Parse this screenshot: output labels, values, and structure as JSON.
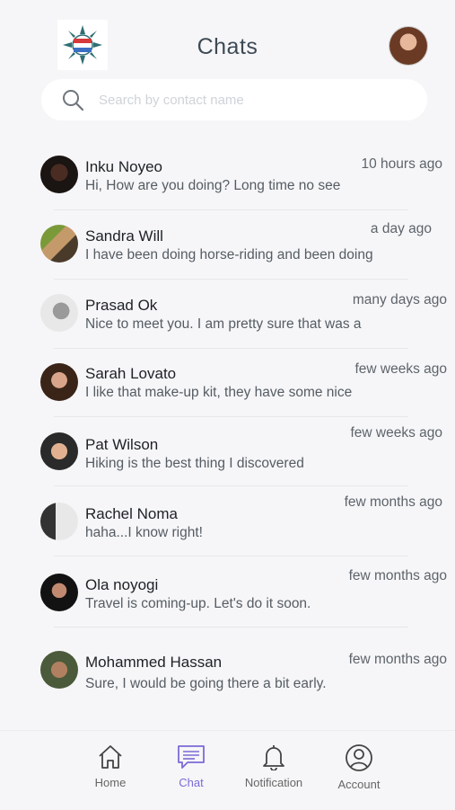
{
  "header": {
    "title": "Chats"
  },
  "search": {
    "placeholder": "Search by contact name",
    "value": ""
  },
  "chats": [
    {
      "name": "Inku Noyeo",
      "preview": "Hi, How are you doing? Long time no see",
      "time": "10 hours ago"
    },
    {
      "name": "Sandra Will",
      "preview": "I have been doing horse-riding and been doing",
      "time": "a day ago"
    },
    {
      "name": "Prasad Ok",
      "preview": "Nice to meet you. I am pretty sure that was a",
      "time": "many days ago"
    },
    {
      "name": "Sarah Lovato",
      "preview": "I like that make-up kit, they have some nice",
      "time": "few weeks ago"
    },
    {
      "name": "Pat Wilson",
      "preview": "Hiking is the best thing I discovered",
      "time": "few weeks ago"
    },
    {
      "name": "Rachel Noma",
      "preview": "haha...I know right!",
      "time": "few months ago"
    },
    {
      "name": "Ola noyogi",
      "preview": "Travel is coming-up. Let's do it soon.",
      "time": "few months ago"
    },
    {
      "name": "Mohammed Hassan",
      "preview": "Sure, I would be going there a bit early.",
      "time": "few months ago"
    }
  ],
  "nav": {
    "home": "Home",
    "chat": "Chat",
    "notification": "Notification",
    "account": "Account"
  },
  "colors": {
    "accent": "#7a6bd6",
    "background": "#f6f6f8"
  }
}
